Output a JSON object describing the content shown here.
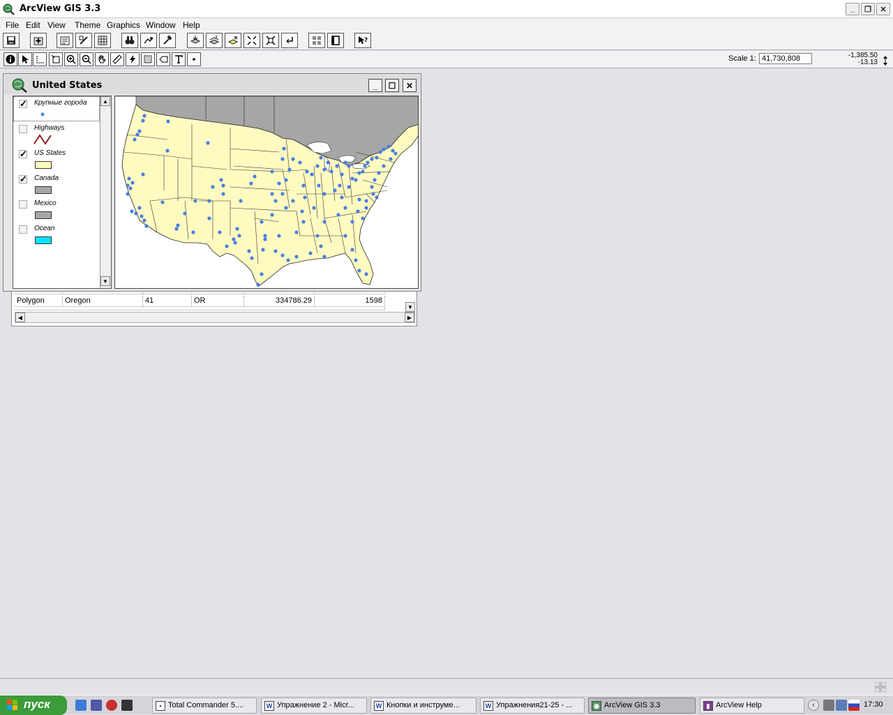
{
  "app": {
    "title": "ArcView GIS 3.3"
  },
  "menu": [
    "File",
    "Edit",
    "View",
    "Theme",
    "Graphics",
    "Window",
    "Help"
  ],
  "toolbar": {
    "scale_label": "Scale 1:",
    "scale_value": "41,730,808",
    "coord_x": "-1,385.50",
    "coord_y": "-13.13"
  },
  "view": {
    "title": "United States",
    "themes": [
      {
        "name": "Крупные города",
        "checked": true,
        "symbol": "point",
        "color": "#4a7fe0"
      },
      {
        "name": "Highways",
        "checked": false,
        "symbol": "line",
        "color": "#8b1a1a"
      },
      {
        "name": "US States",
        "checked": true,
        "symbol": "fill",
        "color": "#fffac0"
      },
      {
        "name": "Canada",
        "checked": true,
        "symbol": "fill",
        "color": "#a6a6a6"
      },
      {
        "name": "Mexico",
        "checked": false,
        "symbol": "fill",
        "color": "#a6a6a6"
      },
      {
        "name": "Ocean",
        "checked": false,
        "symbol": "fill",
        "color": "#00e5ff"
      }
    ]
  },
  "table": {
    "row": [
      "Polygon",
      "Oregon",
      "41",
      "OR",
      "334786.29",
      "1598"
    ]
  },
  "taskbar": {
    "start": "пуск",
    "tasks": [
      "Total Commander 5....",
      "Упражнение 2 - Micr...",
      "Кнопки и инструме...",
      "Упражнения21-25 - ...",
      "ArcView GIS 3.3",
      "ArcView Help"
    ],
    "clock": "17:30"
  },
  "colors": {
    "state_fill": "#fffac0",
    "canada": "#a6a6a6",
    "city": "#4a7fe0"
  }
}
